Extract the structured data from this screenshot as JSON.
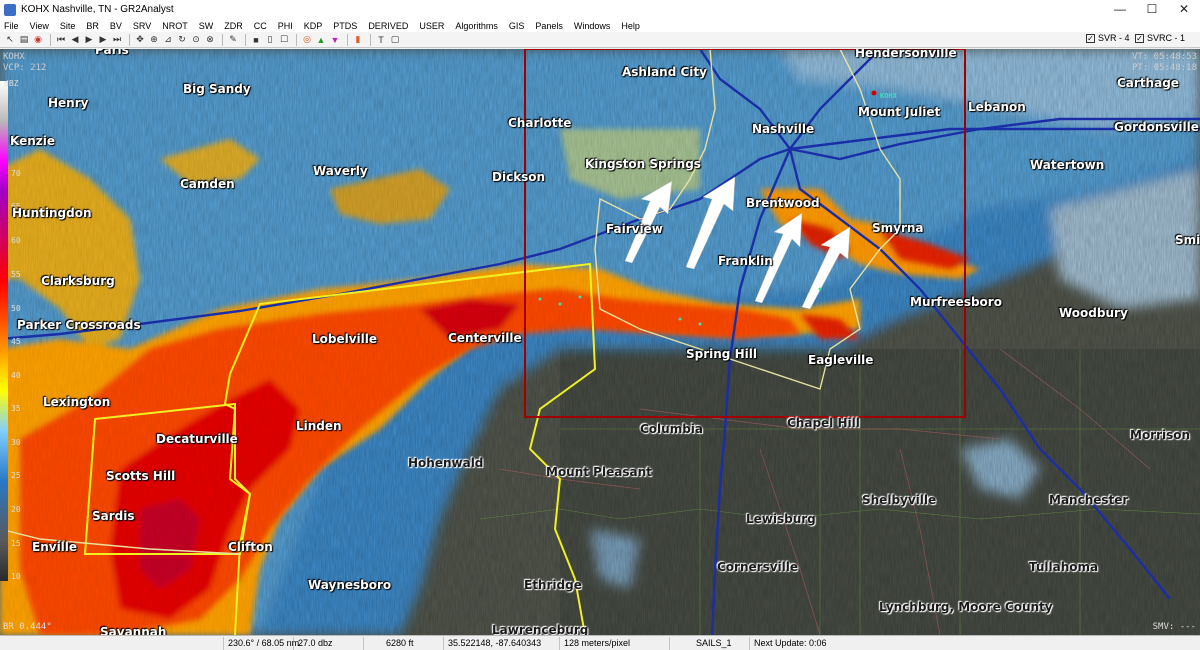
{
  "window": {
    "title": "KOHX Nashville, TN - GR2Analyst",
    "minimize": "—",
    "maximize": "☐",
    "close": "✕"
  },
  "menu": [
    "File",
    "View",
    "Site",
    "BR",
    "BV",
    "SRV",
    "NROT",
    "SW",
    "ZDR",
    "CC",
    "PHI",
    "KDP",
    "PTDS",
    "DERIVED",
    "USER",
    "Algorithms",
    "GIS",
    "Panels",
    "Windows",
    "Help"
  ],
  "toolbar": {
    "svr_label": "SVR - 4",
    "svrc_label": "SVRC - 1"
  },
  "map": {
    "radar_site": "KOHX",
    "vcp": "VCP: 212",
    "vt": "VT: 05:48:53",
    "pt": "PT: 05:48:18",
    "product": "BR 0.444°",
    "smv": "SMV: ---",
    "site_marker": "KOHX",
    "legend_unit": "dBZ",
    "legend_ticks": [
      "75",
      "70",
      "65",
      "60",
      "55",
      "50",
      "45",
      "40",
      "35",
      "30",
      "25",
      "20",
      "15",
      "10"
    ]
  },
  "cities": [
    {
      "name": "Paris"
    },
    {
      "name": "Big Sandy"
    },
    {
      "name": "Henry"
    },
    {
      "name": "Kenzie"
    },
    {
      "name": "Ashland City"
    },
    {
      "name": "Hendersonville"
    },
    {
      "name": "Carthage"
    },
    {
      "name": "Charlotte"
    },
    {
      "name": "Nashville"
    },
    {
      "name": "Mount Juliet"
    },
    {
      "name": "Lebanon"
    },
    {
      "name": "Gordonsville"
    },
    {
      "name": "Camden"
    },
    {
      "name": "Waverly"
    },
    {
      "name": "Dickson"
    },
    {
      "name": "Kingston Springs"
    },
    {
      "name": "Watertown"
    },
    {
      "name": "Huntingdon"
    },
    {
      "name": "Brentwood"
    },
    {
      "name": "Smyrna"
    },
    {
      "name": "Fairview"
    },
    {
      "name": "Smit"
    },
    {
      "name": "Franklin"
    },
    {
      "name": "Clarksburg"
    },
    {
      "name": "Murfreesboro"
    },
    {
      "name": "Parker Crossroads"
    },
    {
      "name": "Woodbury"
    },
    {
      "name": "Lobelville"
    },
    {
      "name": "Centerville"
    },
    {
      "name": "Spring Hill"
    },
    {
      "name": "Eagleville"
    },
    {
      "name": "Lexington"
    },
    {
      "name": "Columbia"
    },
    {
      "name": "Chapel Hill"
    },
    {
      "name": "Linden"
    },
    {
      "name": "Decaturville"
    },
    {
      "name": "Morrison"
    },
    {
      "name": "Hohenwald"
    },
    {
      "name": "Scotts Hill"
    },
    {
      "name": "Mount Pleasant"
    },
    {
      "name": "Shelbyville"
    },
    {
      "name": "Manchester"
    },
    {
      "name": "Sardis"
    },
    {
      "name": "Lewisburg"
    },
    {
      "name": "Enville"
    },
    {
      "name": "Clifton"
    },
    {
      "name": "Cornersville"
    },
    {
      "name": "Tullahoma"
    },
    {
      "name": "Waynesboro"
    },
    {
      "name": "Ethridge"
    },
    {
      "name": "Lynchburg, Moore County"
    },
    {
      "name": "Savannah"
    },
    {
      "name": "Lawrenceburg"
    }
  ],
  "status": {
    "azimuth": "230.6° / 68.05 nm",
    "value": "27.0 dbz",
    "height": "6280 ft",
    "coords": "35.522148, -87.640343",
    "scale": "128 meters/pixel",
    "mode": "SAILS_1",
    "next_update": "Next Update: 0:06"
  }
}
